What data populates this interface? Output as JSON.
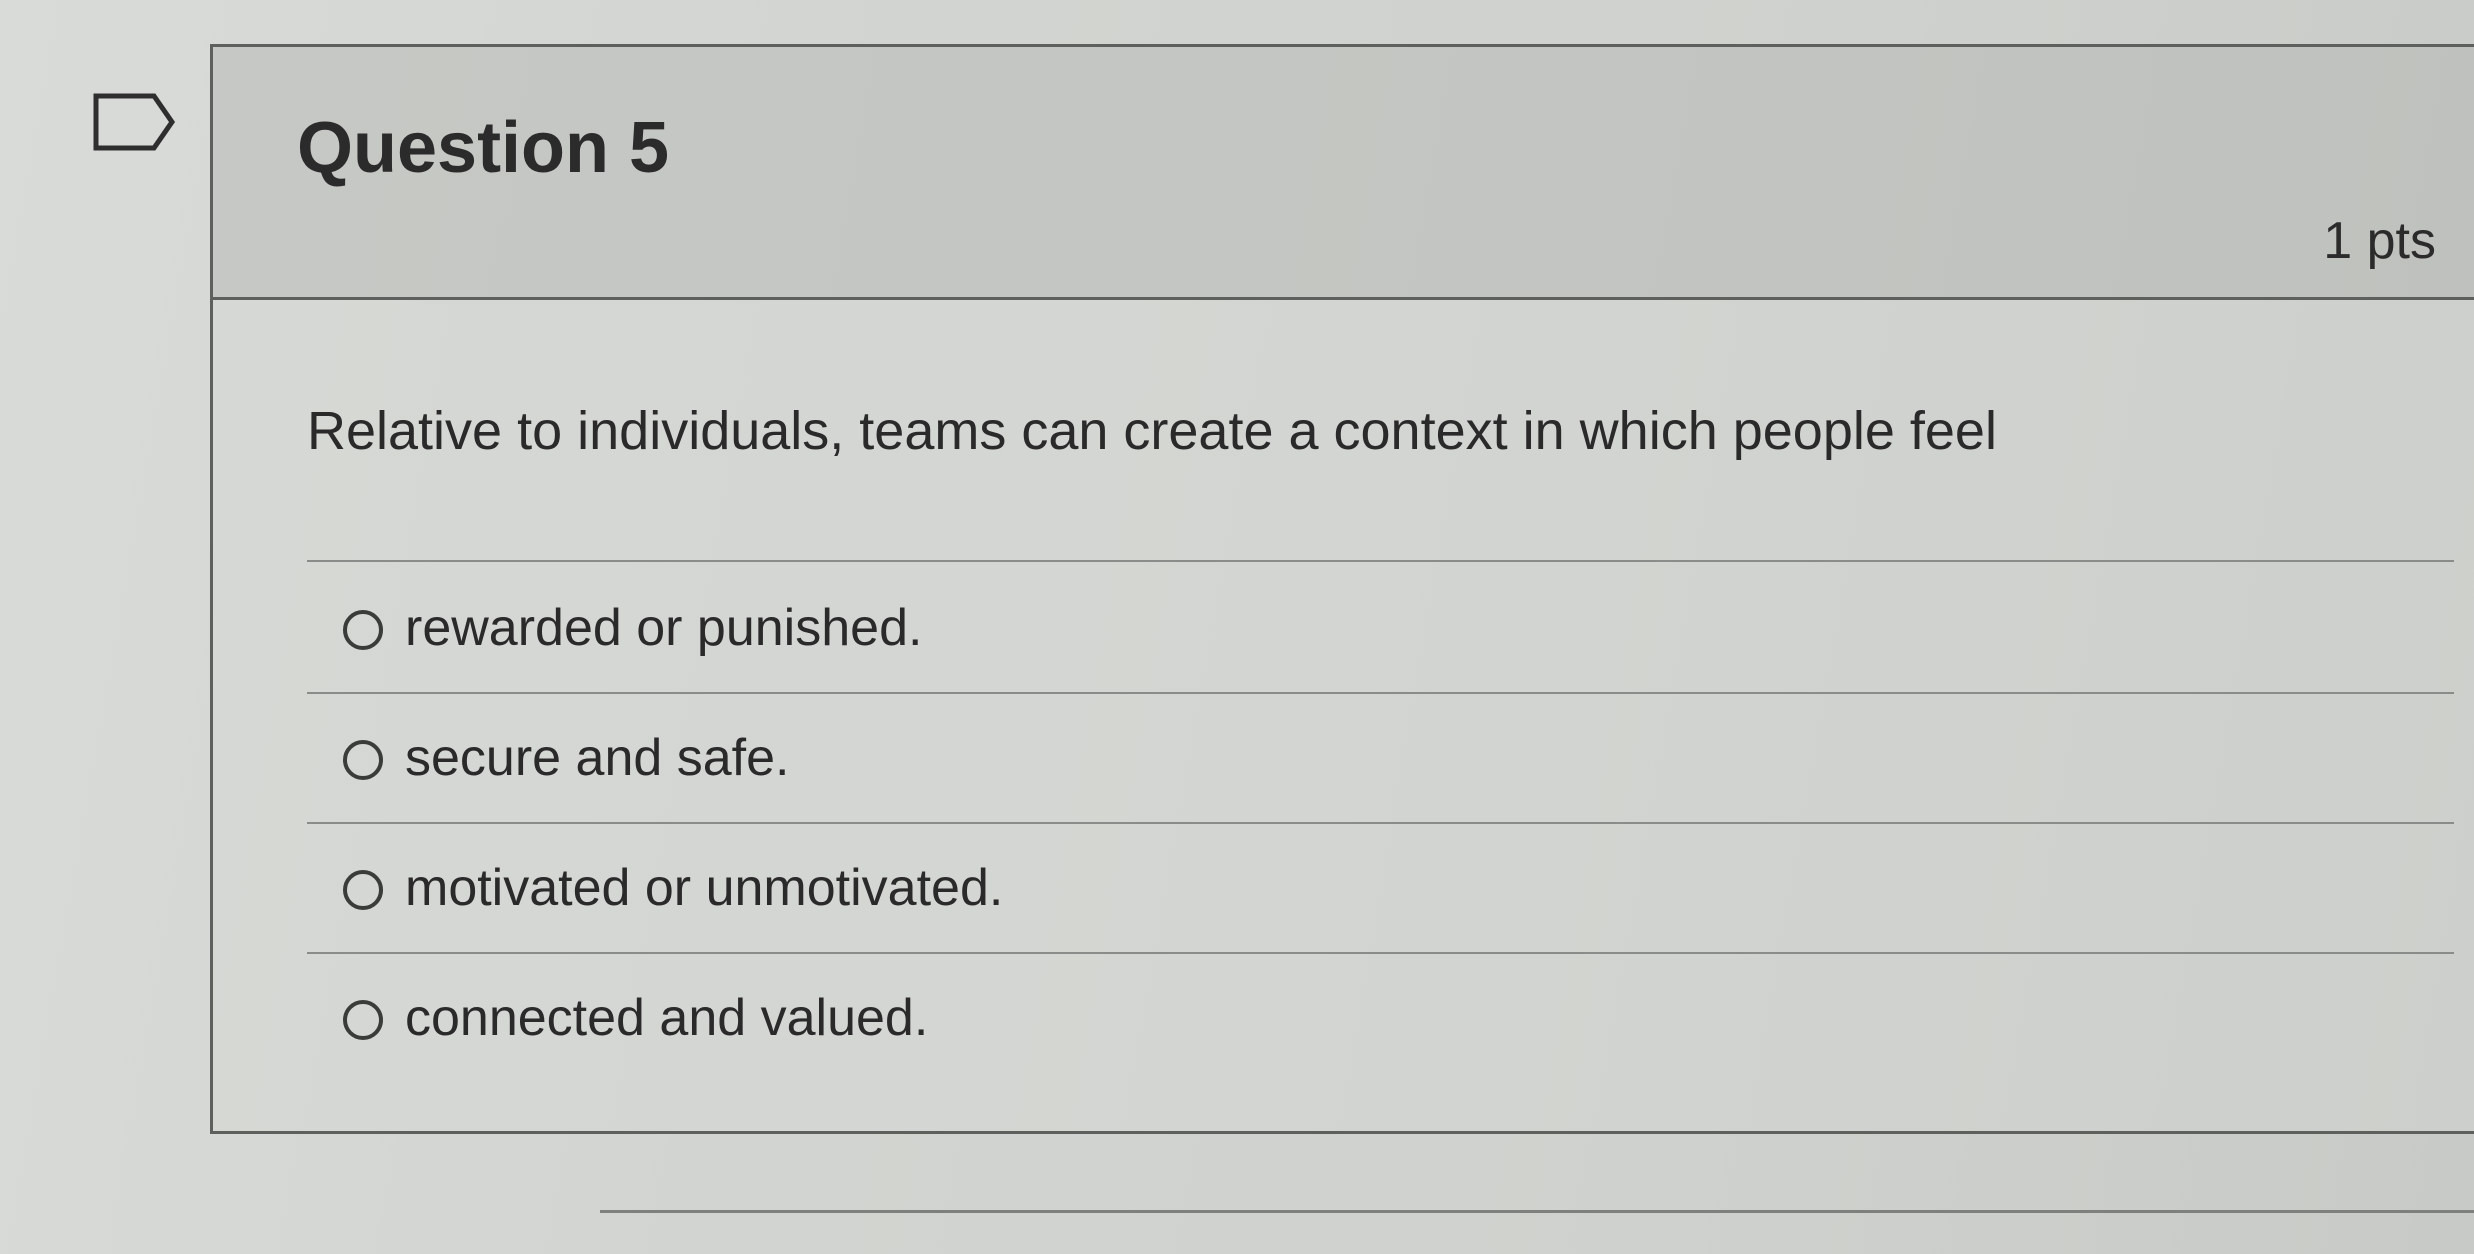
{
  "question": {
    "title": "Question 5",
    "points": "1 pts",
    "text": "Relative to individuals, teams can create a context in which people feel",
    "answers": [
      {
        "label": "rewarded or punished."
      },
      {
        "label": "secure and safe."
      },
      {
        "label": "motivated or unmotivated."
      },
      {
        "label": "connected and valued."
      }
    ]
  },
  "icons": {
    "flag": "flag-question-icon",
    "radio": "radio-button-unselected"
  },
  "colors": {
    "border": "#5e605e",
    "text": "#2a2a2a",
    "header_background": "#c4c6c3"
  }
}
